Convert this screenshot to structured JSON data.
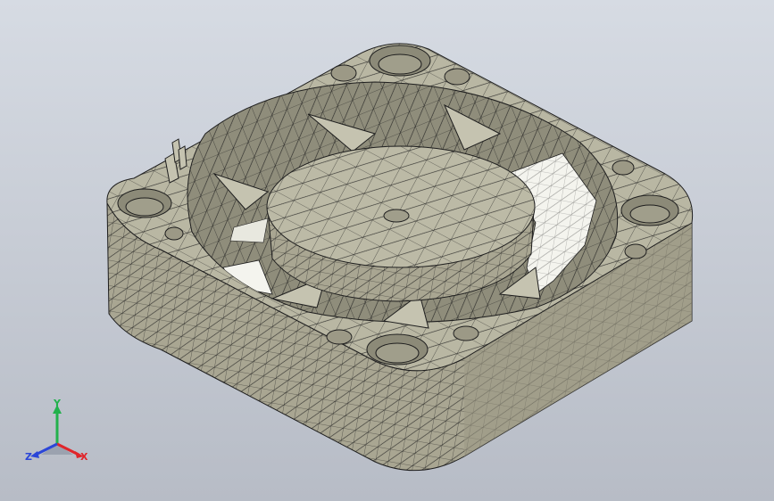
{
  "viewport": {
    "background_top": "#d6dbe3",
    "background_bottom": "#b7bcc6"
  },
  "model": {
    "shade_top": "#b9b7a3",
    "shade_side": "#a9a692",
    "shade_dark": "#8c8a78",
    "mesh_color": "#1e1e1e",
    "highlight": "#f4f4ee"
  },
  "triad": {
    "x_label": "X",
    "y_label": "Y",
    "z_label": "Z",
    "x_color": "#e0262b",
    "y_color": "#22b14c",
    "z_color": "#2b46d8"
  }
}
